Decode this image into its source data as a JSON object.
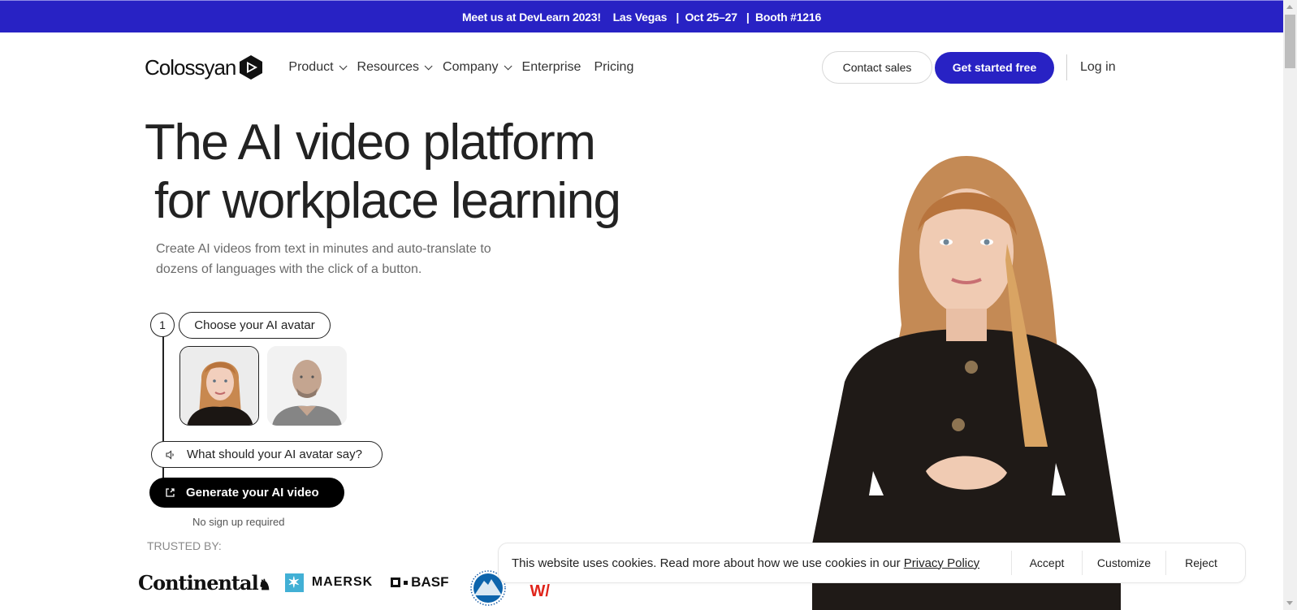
{
  "announcement": {
    "event": "Meet us at DevLearn 2023!",
    "location": "Las Vegas",
    "dates": "Oct 25–27",
    "booth": "Booth #1216",
    "separator": "|",
    "background_color": "#2822c4"
  },
  "nav": {
    "logo_text": "Colossyan",
    "links": [
      {
        "label": "Product",
        "dropdown": true
      },
      {
        "label": "Resources",
        "dropdown": true
      },
      {
        "label": "Company",
        "dropdown": true
      },
      {
        "label": "Enterprise",
        "dropdown": false
      },
      {
        "label": "Pricing",
        "dropdown": false
      }
    ],
    "contact_sales": "Contact sales",
    "get_started": "Get started free",
    "login": "Log in",
    "accent_color": "#2822c4"
  },
  "hero": {
    "title_line1": "The AI video platform",
    "title_line2": "for workplace learning",
    "subtitle": "Create AI videos from text in minutes and auto-translate to dozens of languages with the click of a button."
  },
  "demo": {
    "step_number": "1",
    "choose_label": "Choose your AI avatar",
    "avatars": [
      {
        "name": "female-avatar",
        "selected": true
      },
      {
        "name": "male-avatar",
        "selected": false
      }
    ],
    "say_placeholder": "What should your AI avatar say?",
    "generate_label": "Generate your AI video",
    "no_signup": "No sign up required"
  },
  "trusted": {
    "label": "TRUSTED BY:",
    "logos": [
      "Continental",
      "MAERSK",
      "BASF",
      "Paramount",
      "partial-red-logo"
    ]
  },
  "cookie": {
    "text": "This website uses cookies. Read more about how we use cookies in our ",
    "link": "Privacy Policy",
    "accept": "Accept",
    "customize": "Customize",
    "reject": "Reject"
  }
}
